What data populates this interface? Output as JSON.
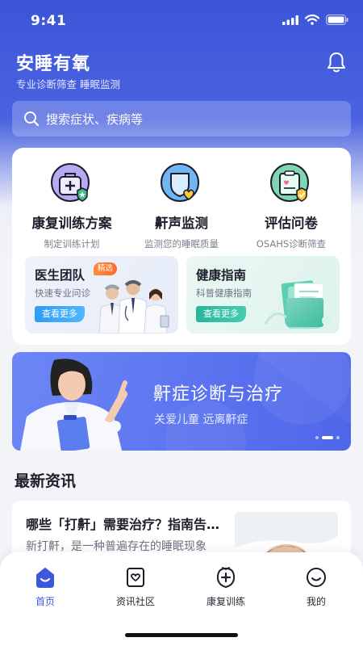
{
  "status_bar": {
    "time": "9:41"
  },
  "header": {
    "title": "安睡有氧",
    "subtitle": "专业诊断筛查  睡眠监测"
  },
  "search": {
    "placeholder": "搜索症状、疾病等"
  },
  "services": [
    {
      "title": "康复训练方案",
      "subtitle": "制定训练计划",
      "icon": "rehab-kit-icon"
    },
    {
      "title": "鼾声监测",
      "subtitle": "监测您的睡眠质量",
      "icon": "snore-monitor-icon"
    },
    {
      "title": "评估问卷",
      "subtitle": "OSAHS诊断筛查",
      "icon": "questionnaire-icon"
    }
  ],
  "features": {
    "doctors": {
      "title": "医生团队",
      "badge": "精选",
      "subtitle": "快速专业问诊",
      "button": "查看更多"
    },
    "guide": {
      "title": "健康指南",
      "subtitle": "科普健康指南",
      "button": "查看更多"
    }
  },
  "banner": {
    "title": "鼾症诊断与治疗",
    "subtitle": "关爱儿童 远离鼾症",
    "slide_count": 3,
    "active_slide": 2
  },
  "news": {
    "heading": "最新资讯",
    "items": [
      {
        "title": "哪些「打鼾」需要治疗？指南告诉你",
        "excerpt": "新打鼾，是一种普遍存在的睡眠现象"
      }
    ]
  },
  "tabbar": [
    {
      "label": "首页",
      "icon": "home-icon",
      "active": true
    },
    {
      "label": "资讯社区",
      "icon": "news-community-icon",
      "active": false
    },
    {
      "label": "康复训练",
      "icon": "rehab-training-icon",
      "active": false
    },
    {
      "label": "我的",
      "icon": "profile-icon",
      "active": false
    }
  ],
  "colors": {
    "primary": "#3d57dd",
    "banner": "#5a72ee",
    "badge": "#ff7a33",
    "doctor_button": "#2f9cf5",
    "guide_button": "#2ab59a"
  }
}
